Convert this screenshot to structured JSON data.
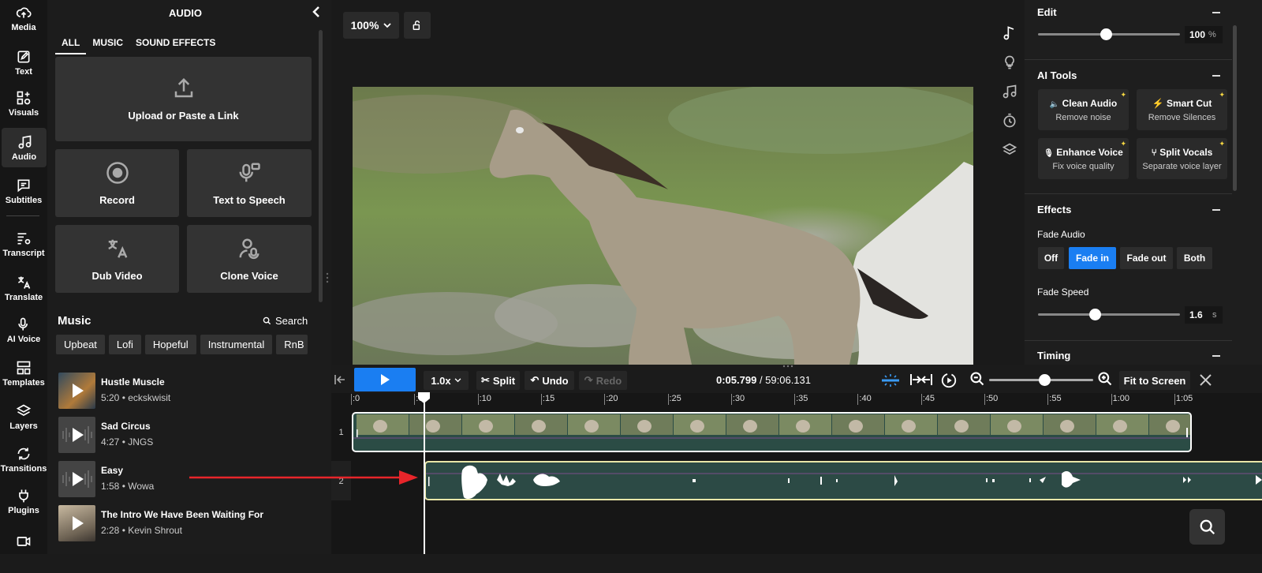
{
  "nav": {
    "items": [
      {
        "label": "Media",
        "icon": "cloud-upload-icon"
      },
      {
        "label": "Text",
        "icon": "pencil-icon"
      },
      {
        "label": "Visuals",
        "icon": "shapes-icon"
      },
      {
        "label": "Audio",
        "icon": "music-note-icon",
        "active": true
      },
      {
        "label": "Subtitles",
        "icon": "caption-icon"
      },
      {
        "label": "Transcript",
        "icon": "transcript-icon"
      },
      {
        "label": "Translate",
        "icon": "translate-icon"
      },
      {
        "label": "AI Voice",
        "icon": "ai-voice-icon"
      },
      {
        "label": "Templates",
        "icon": "templates-icon"
      },
      {
        "label": "Layers",
        "icon": "layers-icon"
      },
      {
        "label": "Transitions",
        "icon": "transitions-icon"
      },
      {
        "label": "Plugins",
        "icon": "plug-icon"
      }
    ]
  },
  "audio_panel": {
    "title": "AUDIO",
    "tabs": [
      "ALL",
      "MUSIC",
      "SOUND EFFECTS"
    ],
    "upload_label": "Upload or Paste a Link",
    "record_label": "Record",
    "tts_label": "Text to Speech",
    "dub_label": "Dub Video",
    "clone_label": "Clone Voice",
    "music_heading": "Music",
    "search_label": "Search",
    "chips": [
      "Upbeat",
      "Lofi",
      "Hopeful",
      "Instrumental",
      "RnB"
    ],
    "tracks": [
      {
        "title": "Hustle Muscle",
        "meta": "5:20 • eckskwisit"
      },
      {
        "title": "Sad Circus",
        "meta": "4:27 • JNGS"
      },
      {
        "title": "Easy",
        "meta": "1:58 • Wowa"
      },
      {
        "title": "The Intro We Have Been Waiting For",
        "meta": "2:28 • Kevin Shrout"
      }
    ]
  },
  "preview": {
    "zoom": "100%"
  },
  "right_panel": {
    "edit": {
      "title": "Edit",
      "volume_value": "100",
      "volume_unit": "%",
      "volume_fraction": 0.48
    },
    "ai_tools": {
      "title": "AI Tools",
      "cards": [
        {
          "title": "Clean Audio",
          "sub": "Remove noise",
          "icon": "speaker-icon"
        },
        {
          "title": "Smart Cut",
          "sub": "Remove Silences",
          "icon": "bolt-icon"
        },
        {
          "title": "Enhance Voice",
          "sub": "Fix voice quality",
          "icon": "mic-icon"
        },
        {
          "title": "Split Vocals",
          "sub": "Separate voice layer",
          "icon": "split-icon"
        }
      ]
    },
    "effects": {
      "title": "Effects",
      "fade_label": "Fade Audio",
      "fade_options": [
        "Off",
        "Fade in",
        "Fade out",
        "Both"
      ],
      "fade_active": "Fade in",
      "speed_label": "Fade Speed",
      "speed_value": "1.6",
      "speed_unit": "s",
      "speed_fraction": 0.4
    },
    "timing": {
      "title": "Timing"
    }
  },
  "timeline": {
    "speed": "1.0x",
    "split_label": "Split",
    "undo_label": "Undo",
    "redo_label": "Redo",
    "time_current": "0:05.799",
    "time_separator": " / ",
    "time_total": "59:06.131",
    "fit_label": "Fit to Screen",
    "ruler": [
      ":0",
      ":05",
      ":10",
      ":15",
      ":20",
      ":25",
      ":30",
      ":35",
      ":40",
      ":45",
      ":50",
      ":55",
      "1:00",
      "1:05"
    ],
    "track_numbers": [
      "1",
      "2"
    ]
  }
}
